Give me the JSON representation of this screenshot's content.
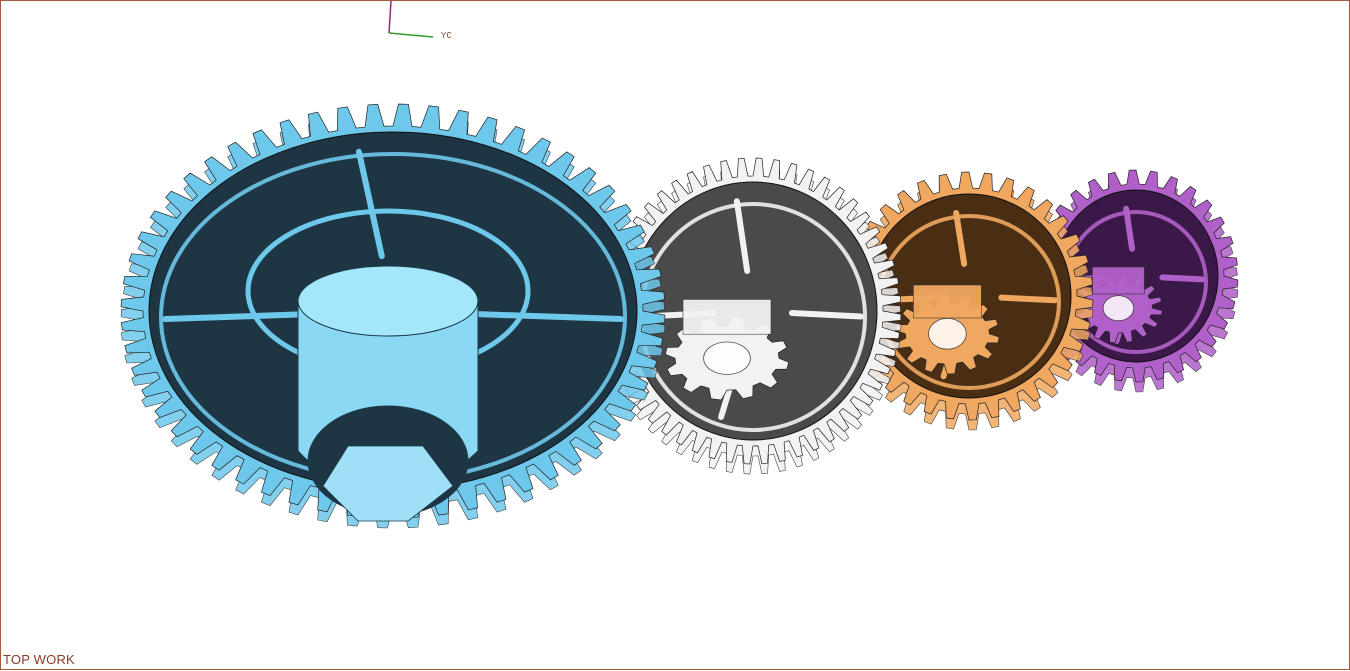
{
  "viewport": {
    "view_name": "TOP WORK",
    "axis_label": "YC",
    "colors": {
      "border": "#a05a3c",
      "background": "#ffffff",
      "axis_vertical": "#8a2a8a",
      "axis_horizontal": "#2aa02a"
    }
  },
  "gears": [
    {
      "name": "large-cyan-gear",
      "teeth": 56,
      "color": "#6ec8ec",
      "dark": "#1e3644",
      "pinion_teeth": 0
    },
    {
      "name": "white-gear",
      "teeth": 52,
      "color": "#f2f2f2",
      "dark": "#4a4a4a",
      "pinion_teeth": 12
    },
    {
      "name": "orange-gear",
      "teeth": 34,
      "color": "#f0a860",
      "dark": "#4a2e14",
      "pinion_teeth": 14
    },
    {
      "name": "purple-gear",
      "teeth": 30,
      "color": "#b060c8",
      "dark": "#3a1848",
      "pinion_teeth": 16
    }
  ]
}
